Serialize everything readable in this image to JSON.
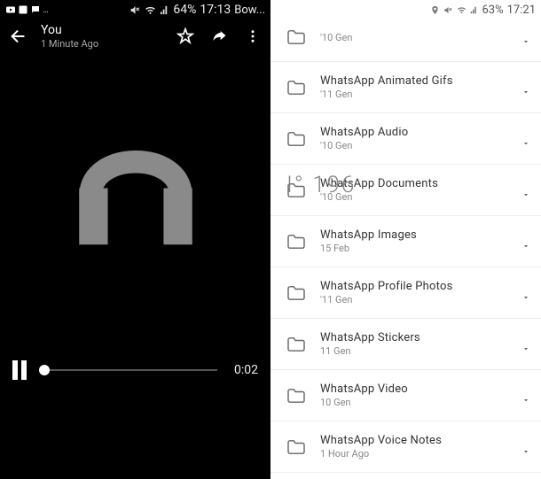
{
  "left": {
    "status": {
      "battery": "64%",
      "time": "17:13",
      "extra": "Bow..."
    },
    "header": {
      "title": "You",
      "subtitle": "1 Minute Ago"
    },
    "player": {
      "time": "0:02"
    }
  },
  "right": {
    "status": {
      "battery": "63%",
      "time": "17:21"
    },
    "overlay": "I° 196",
    "folders": [
      {
        "name": "",
        "date": "'10 Gen"
      },
      {
        "name": "WhatsApp Animated Gifs",
        "date": "'11 Gen"
      },
      {
        "name": "WhatsApp Audio",
        "date": "'10 Gen"
      },
      {
        "name": "WhatsApp Documents",
        "date": "'10 Gen"
      },
      {
        "name": "WhatsApp Images",
        "date": "15 Feb"
      },
      {
        "name": "WhatsApp Profile Photos",
        "date": "'11 Gen"
      },
      {
        "name": "WhatsApp Stickers",
        "date": "11 Gen"
      },
      {
        "name": "WhatsApp Video",
        "date": "10 Gen"
      },
      {
        "name": "WhatsApp Voice Notes",
        "date": "1 Hour Ago"
      }
    ]
  }
}
